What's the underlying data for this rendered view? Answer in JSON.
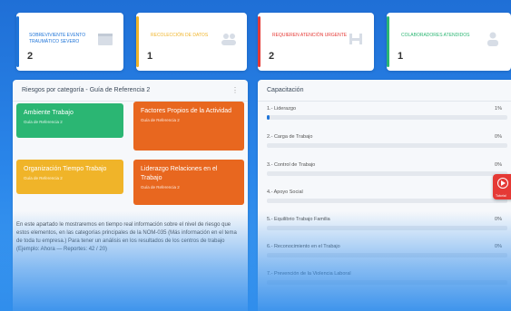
{
  "stats": [
    {
      "label": "Sobreviviente evento traumático severo",
      "value": "2",
      "color": "#1e74d8"
    },
    {
      "label": "Recolección de datos",
      "value": "1",
      "color": "#f0b429"
    },
    {
      "label": "Requieren Atención Urgente",
      "value": "2",
      "color": "#e53935"
    },
    {
      "label": "Colaboradores Atendidos",
      "value": "1",
      "color": "#2bb673"
    }
  ],
  "left_panel": {
    "title": "Riesgos por categoría - Guía de Referencia 2",
    "menu_icon": "more-vertical-icon",
    "tiles": [
      {
        "title": "Ambiente Trabajo",
        "sub": "Guía de Referencia 2",
        "color": "#2bb673"
      },
      {
        "title": "Factores Propios de la Actividad",
        "sub": "Guía de Referencia 2",
        "color": "#e8671f"
      },
      {
        "title": "Organización Tiempo Trabajo",
        "sub": "Guía de Referencia 2",
        "color": "#f0b429"
      },
      {
        "title": "Liderazgo Relaciones en el Trabajo",
        "sub": "Guía de Referencia 2",
        "color": "#e8671f"
      }
    ],
    "paragraph": "En este apartado le mostraremos en tiempo real información sobre el nivel de riesgo que estos elementos, en las categorías principales de la NOM-035 (Más información en el tema de toda tu empresa.) Para tener un análisis en los resultados de los centros de trabajo (Ejemplo: Ahora — Reportes: 42 / 20)"
  },
  "right_panel": {
    "title": "Capacitación",
    "rows": [
      {
        "name": "1.- Liderazgo",
        "pct": "1%",
        "value": 1
      },
      {
        "name": "2.- Carga de Trabajo",
        "pct": "0%",
        "value": 0
      },
      {
        "name": "3.- Control de Trabajo",
        "pct": "0%",
        "value": 0
      },
      {
        "name": "4.- Apoyo Social",
        "pct": "0%",
        "value": 0
      },
      {
        "name": "5.- Equilibrio Trabajo Familia",
        "pct": "0%",
        "value": 0
      },
      {
        "name": "6.- Reconocimiento en el Trabajo",
        "pct": "0%",
        "value": 0
      },
      {
        "name": "7.- Prevención de la Violencia Laboral",
        "pct": "",
        "value": 0
      }
    ]
  },
  "fab": {
    "label": "Tutorial",
    "icon": "play-circle-icon"
  }
}
